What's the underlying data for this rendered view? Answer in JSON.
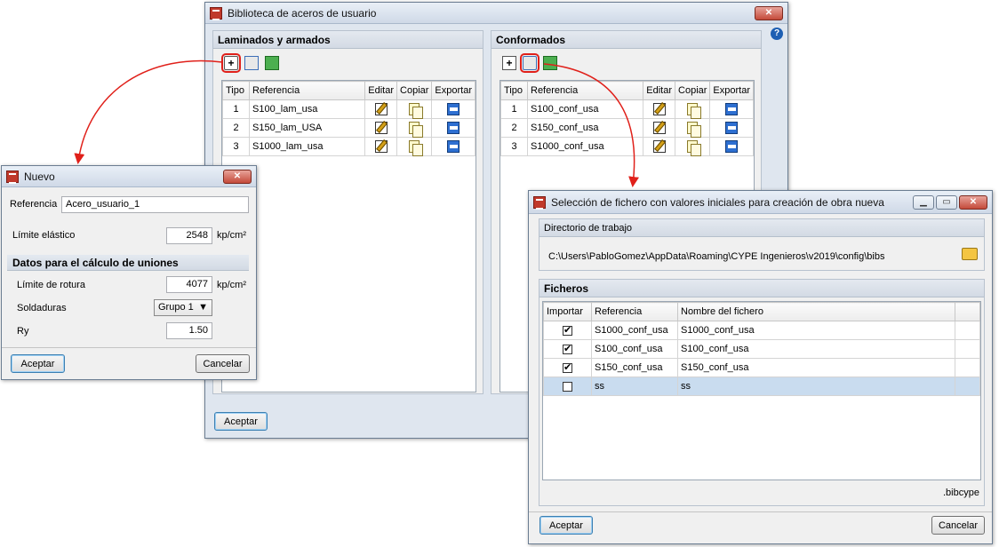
{
  "main_window": {
    "title": "Biblioteca de aceros de usuario",
    "close": "✕",
    "accept": "Aceptar",
    "help": "?",
    "left_panel": {
      "title": "Laminados y armados",
      "columns": [
        "Tipo",
        "Referencia",
        "Editar",
        "Copiar",
        "Exportar"
      ],
      "rows": [
        {
          "tipo": "1",
          "referencia": "S100_lam_usa"
        },
        {
          "tipo": "2",
          "referencia": "S150_lam_USA"
        },
        {
          "tipo": "3",
          "referencia": "S1000_lam_usa"
        }
      ]
    },
    "right_panel": {
      "title": "Conformados",
      "columns": [
        "Tipo",
        "Referencia",
        "Editar",
        "Copiar",
        "Exportar"
      ],
      "rows": [
        {
          "tipo": "1",
          "referencia": "S100_conf_usa"
        },
        {
          "tipo": "2",
          "referencia": "S150_conf_usa"
        },
        {
          "tipo": "3",
          "referencia": "S1000_conf_usa"
        }
      ]
    }
  },
  "nuevo_dialog": {
    "title": "Nuevo",
    "close": "✕",
    "referencia_label": "Referencia",
    "referencia_value": "Acero_usuario_1",
    "limite_elastico_label": "Límite elástico",
    "limite_elastico_value": "2548",
    "unit_1": "kp/cm²",
    "section_title": "Datos para el cálculo de uniones",
    "limite_rotura_label": "Límite de rotura",
    "limite_rotura_value": "4077",
    "unit_2": "kp/cm²",
    "soldaduras_label": "Soldaduras",
    "soldaduras_value": "Grupo 1",
    "ry_label": "Ry",
    "ry_value": "1.50",
    "accept": "Aceptar",
    "cancel": "Cancelar"
  },
  "file_dialog": {
    "title": "Selección de fichero con valores iniciales para creación de obra nueva",
    "minimize": "▁",
    "maximize": "▭",
    "close": "✕",
    "dir_section": "Directorio de trabajo",
    "dir_path": "C:\\Users\\PabloGomez\\AppData\\Roaming\\CYPE Ingenieros\\v2019\\config\\bibs",
    "files_section": "Ficheros",
    "columns": [
      "Importar",
      "Referencia",
      "Nombre del fichero"
    ],
    "rows": [
      {
        "checked": true,
        "referencia": "S1000_conf_usa",
        "fichero": "S1000_conf_usa"
      },
      {
        "checked": true,
        "referencia": "S100_conf_usa",
        "fichero": "S100_conf_usa"
      },
      {
        "checked": true,
        "referencia": "S150_conf_usa",
        "fichero": "S150_conf_usa"
      },
      {
        "checked": false,
        "referencia": "ss",
        "fichero": "ss"
      }
    ],
    "extension": ".bibcype",
    "accept": "Aceptar",
    "cancel": "Cancelar"
  },
  "colors": {
    "callout_red": "#e0201a",
    "selected_row": "#c9dcef"
  }
}
